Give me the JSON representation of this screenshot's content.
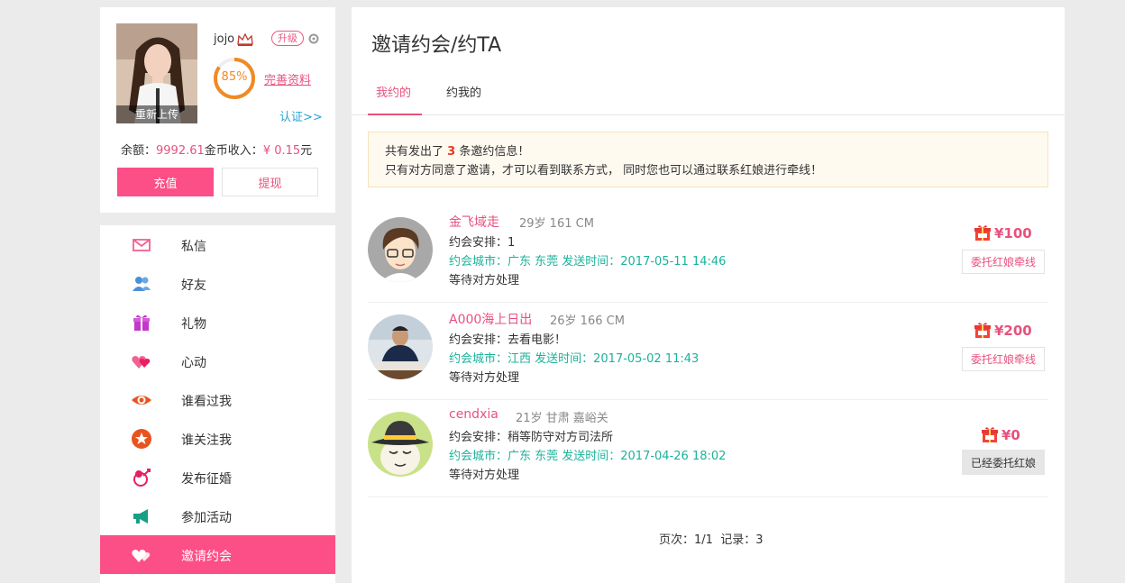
{
  "profile": {
    "reupload_label": "重新上传",
    "username": "jojo",
    "upgrade_label": "升级",
    "progress_percent": 85,
    "progress_text": "85%",
    "complete_label": "完善资料",
    "verify_label": "认证>>",
    "balance_label": "余额：",
    "balance_value": "9992.61",
    "balance_unit": "金币",
    "income_label": "收入：",
    "income_value": "¥ 0.15",
    "income_unit": "元",
    "recharge_label": "充值",
    "withdraw_label": "提现"
  },
  "menu": {
    "items": [
      {
        "label": "私信",
        "icon": "mail-icon"
      },
      {
        "label": "好友",
        "icon": "friends-icon"
      },
      {
        "label": "礼物",
        "icon": "gift-icon"
      },
      {
        "label": "心动",
        "icon": "hearts-icon"
      },
      {
        "label": "谁看过我",
        "icon": "eye-icon"
      },
      {
        "label": "谁关注我",
        "icon": "star-icon"
      },
      {
        "label": "发布征婚",
        "icon": "cupid-icon"
      },
      {
        "label": "参加活动",
        "icon": "megaphone-icon"
      },
      {
        "label": "邀请约会",
        "icon": "hearts-white-icon",
        "active": true
      }
    ]
  },
  "main": {
    "title": "邀请约会/约TA",
    "tabs": [
      {
        "label": "我约的",
        "active": true
      },
      {
        "label": "约我的",
        "active": false
      }
    ],
    "notice": {
      "line1_prefix": "共有发出了",
      "count": "3",
      "line1_suffix": "条邀约信息！",
      "line2": "只有对方同意了邀请，才可以看到联系方式， 同时您也可以通过联系红娘进行牵线！"
    },
    "invites": [
      {
        "name": "金飞域走",
        "meta": "29岁 161 CM",
        "arrangement": "约会安排：1",
        "city_time": "约会城市：广东 东莞 发送时间：2017-05-11 14:46",
        "status": "等待对方处理",
        "price": "¥100",
        "action": "委托红娘牵线",
        "entrusted": false
      },
      {
        "name": "A000海上日出",
        "meta": "26岁 166 CM",
        "arrangement": "约会安排：去看电影！",
        "city_time": "约会城市：江西 发送时间：2017-05-02 11:43",
        "status": "等待对方处理",
        "price": "¥200",
        "action": "委托红娘牵线",
        "entrusted": false
      },
      {
        "name": "cendxia",
        "meta": "21岁 甘肃 嘉峪关",
        "arrangement": "约会安排：稍等防守对方司法所",
        "city_time": "约会城市：广东 东莞 发送时间：2017-04-26 18:02",
        "status": "等待对方处理",
        "price": "¥0",
        "action": "已经委托红娘",
        "entrusted": true
      }
    ],
    "pager": {
      "pages": "页次：1/1",
      "records": "记录：3"
    }
  },
  "colors": {
    "accent": "#fc4f87",
    "pink_text": "#e8517e",
    "teal": "#1bb29a",
    "orange": "#f08a24"
  }
}
